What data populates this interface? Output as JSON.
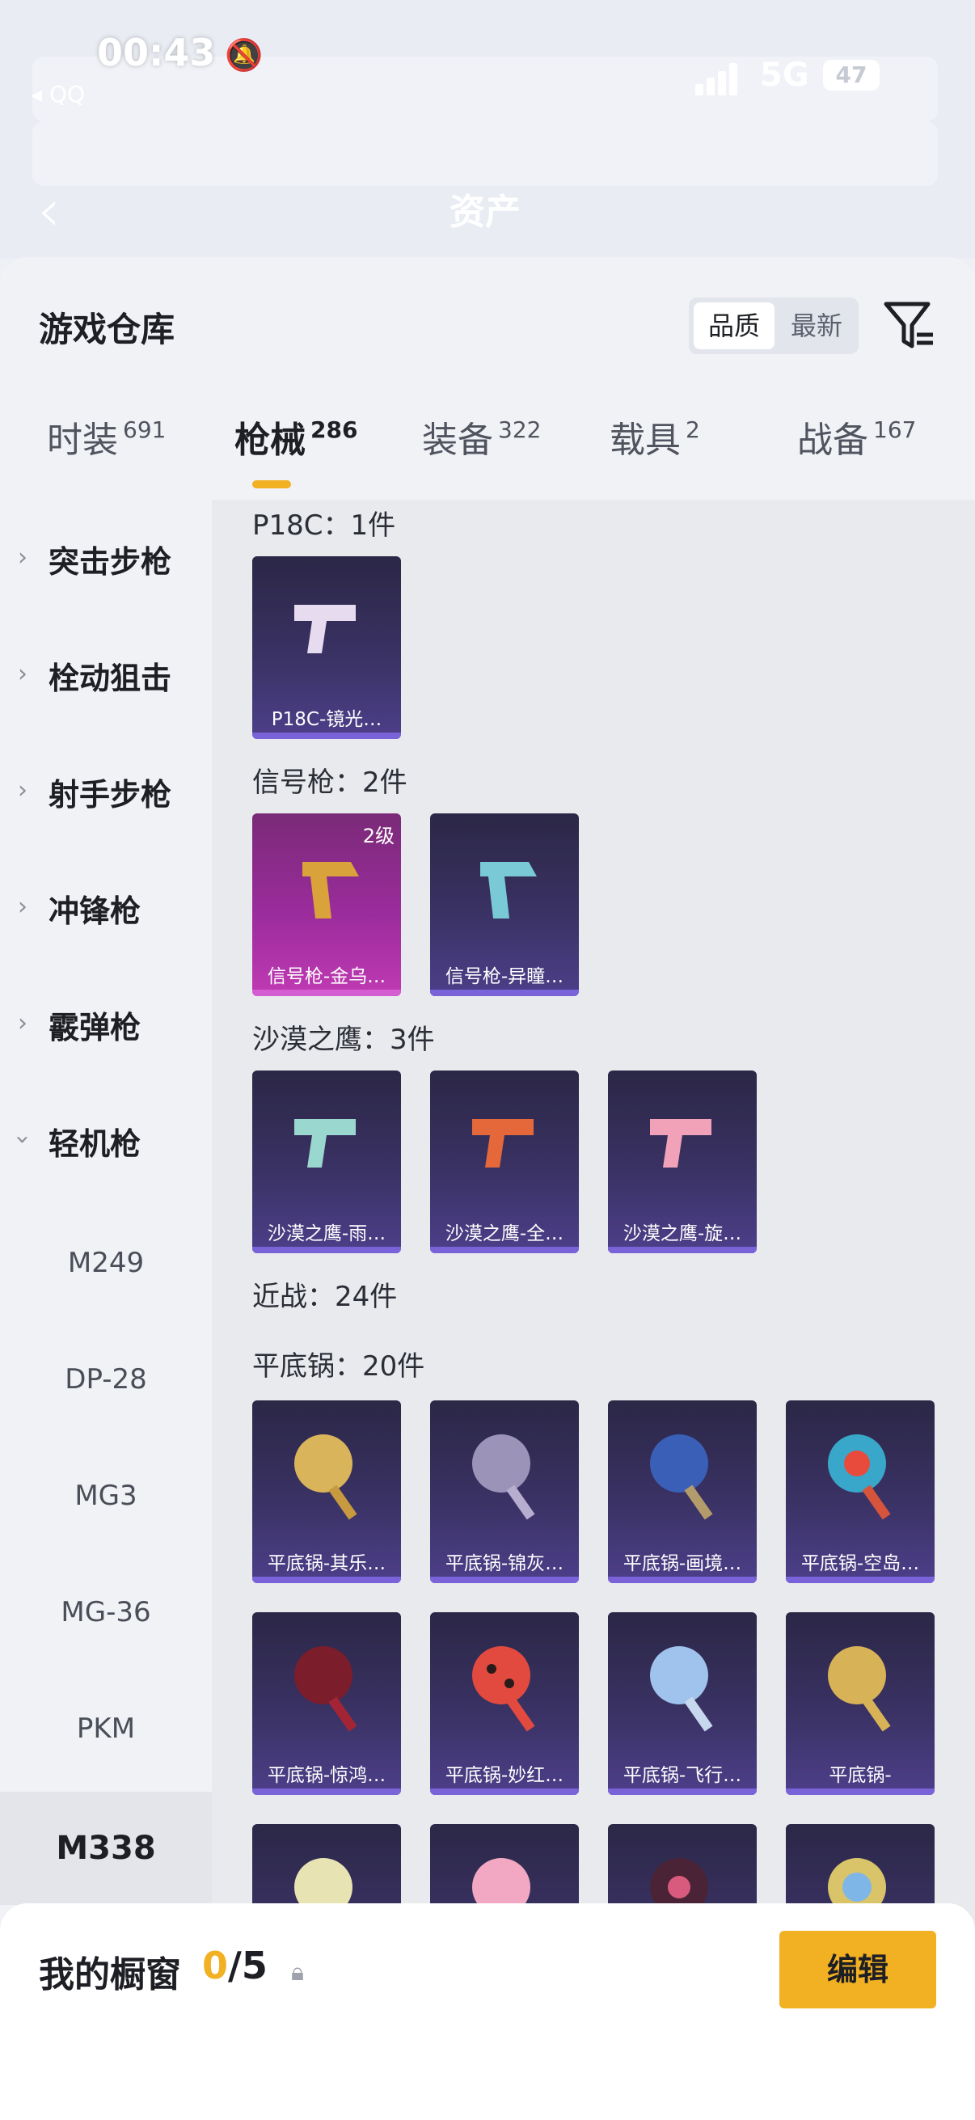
{
  "status": {
    "time": "00:43",
    "back_app": "◂ QQ",
    "network": "5G",
    "battery": "47"
  },
  "bg_header": {
    "page_title": "资产"
  },
  "warehouse": {
    "title": "游戏仓库",
    "sort": {
      "quality": "品质",
      "newest": "最新"
    }
  },
  "tabs": [
    {
      "label": "时装",
      "count": "691"
    },
    {
      "label": "枪械",
      "count": "286"
    },
    {
      "label": "装备",
      "count": "322"
    },
    {
      "label": "载具",
      "count": "2"
    },
    {
      "label": "战备",
      "count": "167"
    }
  ],
  "sidebar": {
    "categories": [
      "突击步枪",
      "栓动狙击",
      "射手步枪",
      "冲锋枪",
      "霰弹枪",
      "轻机枪"
    ],
    "subitems": [
      "M249",
      "DP-28",
      "MG3",
      "MG-36",
      "PKM",
      "M338"
    ]
  },
  "groups": [
    {
      "title": "P18C：1件",
      "items": [
        {
          "name": "P18C-镜光…"
        }
      ]
    },
    {
      "title": "信号枪：2件",
      "items": [
        {
          "name": "信号枪-金乌…",
          "level": "2级"
        },
        {
          "name": "信号枪-异瞳…"
        }
      ]
    },
    {
      "title": "沙漠之鹰：3件",
      "items": [
        {
          "name": "沙漠之鹰-雨…"
        },
        {
          "name": "沙漠之鹰-全…"
        },
        {
          "name": "沙漠之鹰-旋…"
        }
      ]
    },
    {
      "title": "近战：24件"
    },
    {
      "title": "平底锅：20件",
      "items": [
        {
          "name": "平底锅-其乐…"
        },
        {
          "name": "平底锅-锦灰…"
        },
        {
          "name": "平底锅-画境…"
        },
        {
          "name": "平底锅-空岛…"
        },
        {
          "name": "平底锅-惊鸿…"
        },
        {
          "name": "平底锅-妙红…"
        },
        {
          "name": "平底锅-飞行…"
        },
        {
          "name": "平底锅-"
        }
      ]
    }
  ],
  "showcase": {
    "label": "我的橱窗",
    "count": "0",
    "max": "/5",
    "edit": "编辑"
  },
  "colors": {
    "accent": "#f2b023",
    "card_bg": "#3a3264",
    "card_gold": "#c03ab3"
  }
}
